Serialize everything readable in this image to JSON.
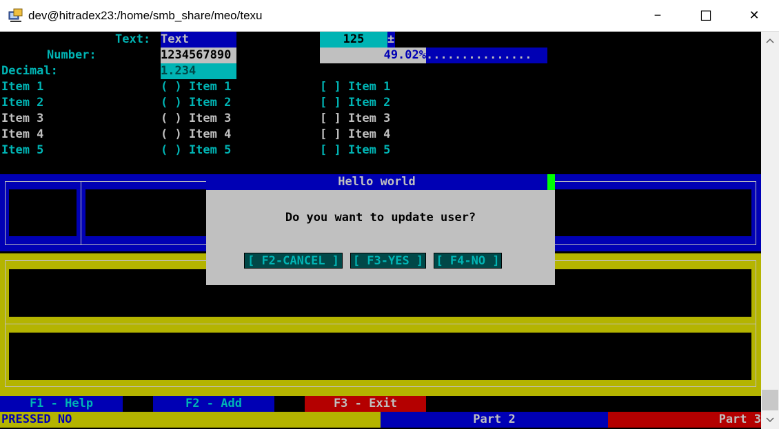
{
  "window": {
    "title": "dev@hitradex23:/home/smb_share/meo/texu",
    "controls": {
      "minimize": "─",
      "maximize": "☐",
      "close": "✕"
    }
  },
  "form": {
    "text_label": "Text:",
    "text_value": "Text",
    "number_label": "Number:",
    "number_value": "1234567890",
    "decimal_label": "Decimal:",
    "decimal_value": "1.234",
    "spinner_value": "125",
    "spinner_symbol": "±",
    "progress_text": "49.02%",
    "progress_fraction": 0.4902,
    "progress_dots": "..............."
  },
  "lists": {
    "plain": [
      "Item 1",
      "Item 2",
      "Item 3",
      "Item 4",
      "Item 5"
    ],
    "radio": [
      "( ) Item 1",
      "( ) Item 2",
      "( ) Item 3",
      "( ) Item 4",
      "( ) Item 5"
    ],
    "check": [
      "[ ] Item 1",
      "[ ] Item 2",
      "[ ] Item 3",
      "[ ] Item 4",
      "[ ] Item 5"
    ]
  },
  "dialog": {
    "title": "Hello world",
    "message": "Do you want to update user?",
    "buttons": [
      "[ F2-CANCEL ]",
      "[ F3-YES ]",
      "[ F4-NO ]"
    ]
  },
  "fkeys": {
    "help": "F1 - Help",
    "add": "F2 - Add",
    "exit": "F3 - Exit"
  },
  "status": {
    "part1": "PRESSED NO",
    "part2": "Part 2",
    "part3": "Part 3"
  },
  "colors": {
    "cyan": "#00b4b4",
    "blue": "#0000b4",
    "yellow": "#b4b400",
    "red": "#b40000",
    "gray": "#c0c0c0",
    "green": "#00ff00"
  }
}
